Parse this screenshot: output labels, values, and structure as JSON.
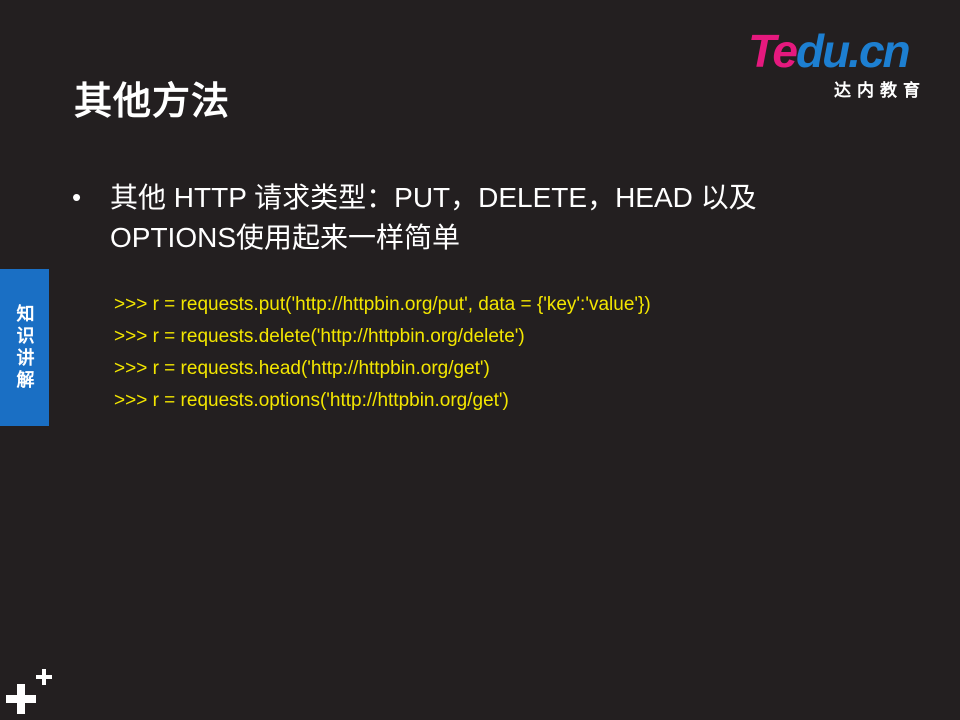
{
  "slide": {
    "title": "其他方法",
    "side_tab": "知识讲解",
    "bullet": {
      "line1": "其他 HTTP 请求类型：PUT，DELETE，HEAD 以及",
      "line2": "OPTIONS使用起来一样简单"
    },
    "code_lines": [
      ">>> r = requests.put('http://httpbin.org/put', data = {'key':'value'})",
      ">>> r = requests.delete('http://httpbin.org/delete')",
      ">>> r = requests.head('http://httpbin.org/get')",
      ">>> r = requests.options('http://httpbin.org/get')"
    ]
  },
  "logo": {
    "brand_pink": "Te",
    "brand_blue": "du.cn",
    "subtitle": "达内教育"
  },
  "colors": {
    "background": "#231f20",
    "code_text": "#f3e600",
    "side_tab": "#1a6fc4",
    "logo_pink": "#e5197e",
    "logo_blue": "#1d7fd1"
  },
  "icons": {
    "corner": "plus-plus-icon"
  }
}
